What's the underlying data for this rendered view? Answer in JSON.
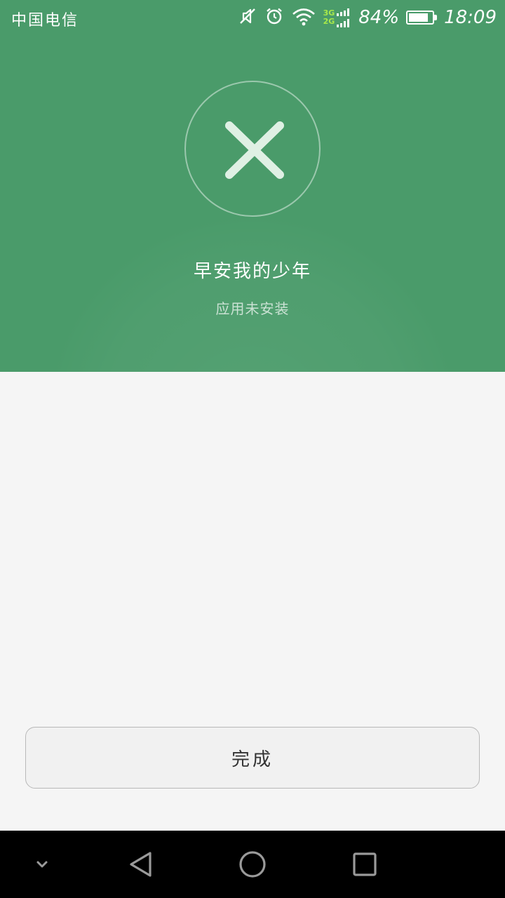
{
  "status_bar": {
    "carrier": "中国电信",
    "network_top": "3G",
    "network_bottom": "2G",
    "battery_percent": "84%",
    "battery_level": 0.84,
    "time": "18:09",
    "icons": [
      "mute-icon",
      "alarm-icon",
      "wifi-icon",
      "signal-icon",
      "battery-icon"
    ]
  },
  "install_result": {
    "app_name": "早安我的少年",
    "status": "应用未安装",
    "result_icon": "close-icon"
  },
  "actions": {
    "done_label": "完成"
  },
  "nav_bar": {
    "items": [
      "hide-nav-icon",
      "back-icon",
      "home-icon",
      "recents-icon"
    ]
  },
  "colors": {
    "header": "#4a9b6a",
    "page_background": "#f5f5f5",
    "network_label": "#a8e84a",
    "nav_background": "#000000"
  }
}
